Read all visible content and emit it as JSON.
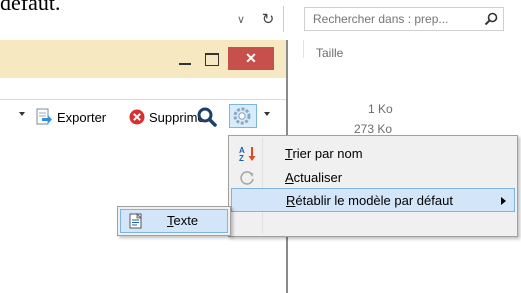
{
  "background": {
    "cut_text": "défaut."
  },
  "explorer": {
    "search": {
      "placeholder": "Rechercher dans : prep..."
    },
    "columns": {
      "size_header": "Taille"
    },
    "rows": [
      {
        "size": "1 Ko"
      },
      {
        "size": "273 Ko"
      }
    ]
  },
  "window": {
    "toolbar": {
      "export_label": "Exporter",
      "delete_label": "Supprimer"
    }
  },
  "context_menu": {
    "items": [
      {
        "label_prefix": "",
        "label_underline": "T",
        "label_rest": "rier par nom",
        "icon": "sort-az-icon"
      },
      {
        "label_prefix": "",
        "label_underline": "A",
        "label_rest": "ctualiser",
        "icon": "refresh-icon"
      },
      {
        "label_prefix": "",
        "label_underline": "R",
        "label_rest": "établir le modèle par défaut",
        "icon": "none",
        "has_submenu": true
      }
    ]
  },
  "submenu": {
    "items": [
      {
        "label_underline": "T",
        "label_rest": "exte",
        "icon": "text-doc-icon"
      }
    ]
  },
  "colors": {
    "title_bar": "#f6e8c1",
    "close_button": "#c7504b",
    "highlight": "#d3e5f8",
    "highlight_border": "#7fb4dc"
  }
}
